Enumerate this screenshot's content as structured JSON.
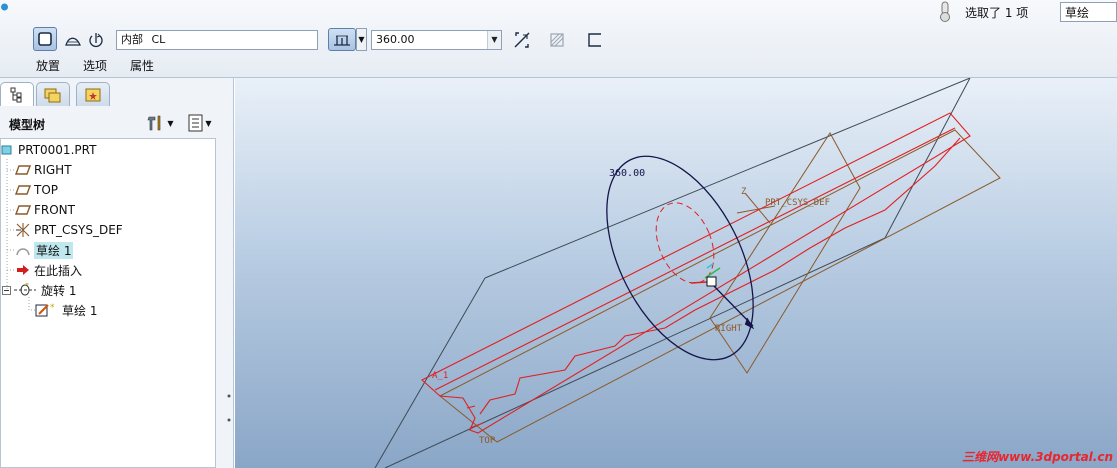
{
  "dashboard": {
    "axis_input": {
      "prefix": "内部",
      "value": "CL"
    },
    "angle_input": {
      "value": "360.00"
    },
    "tabs": [
      "放置",
      "选项",
      "属性"
    ],
    "selection_status": "选取了 1 项",
    "filter_value": "草绘"
  },
  "navigator": {
    "panel_title": "模型树",
    "items": [
      {
        "label": "PRT0001.PRT",
        "icon": "part-icon"
      },
      {
        "label": "RIGHT",
        "icon": "datum-plane-icon"
      },
      {
        "label": "TOP",
        "icon": "datum-plane-icon"
      },
      {
        "label": "FRONT",
        "icon": "datum-plane-icon"
      },
      {
        "label": "PRT_CSYS_DEF",
        "icon": "csys-icon"
      },
      {
        "label": "草绘 1",
        "icon": "sketch-icon"
      },
      {
        "label": "在此插入",
        "icon": "insert-here-arrow-icon"
      },
      {
        "label": "旋转 1",
        "icon": "revolve-icon"
      },
      {
        "label": "草绘 1",
        "icon": "sketch-edit-icon"
      }
    ]
  },
  "graphics": {
    "angle_label": "360.00",
    "csys_label": "PRT_CSYS_DEF",
    "right_label": "RIGHT",
    "top_label": "TOP",
    "a_label": "A_1",
    "z_label": "Z",
    "watermark": "三维网www.3dportal.cn"
  },
  "colors": {
    "sketch_red": "#e02020",
    "datum_brown": "#8a5a2a",
    "dim_navy": "#15154a",
    "highlight": "#bfe7ee"
  }
}
